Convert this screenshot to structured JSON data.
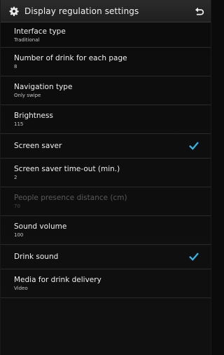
{
  "header": {
    "title": "Display regulation settings",
    "icon": "gear-icon",
    "back_icon": "back-arrow-icon"
  },
  "settings": {
    "interface_type": {
      "label": "Interface type",
      "value": "Traditional"
    },
    "drinks_per_page": {
      "label": "Number of drink for each page",
      "value": "8"
    },
    "navigation_type": {
      "label": "Navigation type",
      "value": "Only swipe"
    },
    "brightness": {
      "label": "Brightness",
      "value": "115"
    },
    "screen_saver": {
      "label": "Screen saver",
      "checked": true
    },
    "screen_saver_timeout": {
      "label": "Screen saver time-out (min.)",
      "value": "2"
    },
    "people_presence_distance": {
      "label": "People presence distance (cm)",
      "value": "70",
      "enabled": false
    },
    "sound_volume": {
      "label": "Sound volume",
      "value": "100"
    },
    "drink_sound": {
      "label": "Drink sound",
      "checked": true
    },
    "media_for_drink_delivery": {
      "label": "Media for drink delivery",
      "value": "Video"
    }
  },
  "colors": {
    "accent_check": "#33b5e5",
    "background": "#0c0c0c",
    "actionbar": "#262626",
    "divider": "#2a2a2a"
  }
}
